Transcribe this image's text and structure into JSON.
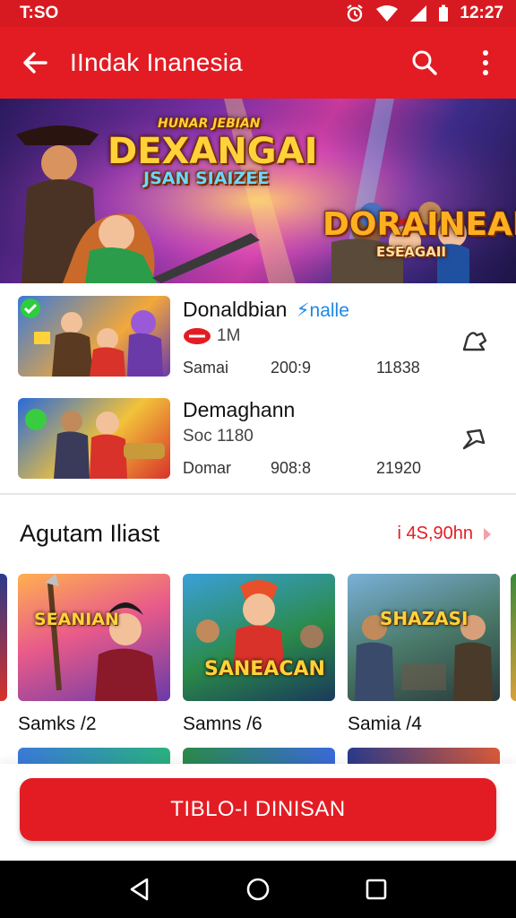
{
  "status_bar": {
    "time": "T:SO",
    "clock": "12:27"
  },
  "app_bar": {
    "title": "IIndak Inanesia"
  },
  "banner": {
    "title_small": "HUNAR JEBIAN",
    "title_main": "DEXANGAI",
    "title_sub": "JSAN SIAIZEE",
    "right_title": "DORAINEAI",
    "right_sub": "ESEAGAII"
  },
  "list": [
    {
      "title": "Donaldbian",
      "tag": "nalle",
      "sub": "1M",
      "stat_label": "Samai",
      "stat_a": "200:9",
      "stat_b": "11838"
    },
    {
      "title": "Demaghann",
      "tag": "",
      "sub": "Soc 1180",
      "stat_label": "Domar",
      "stat_a": "908:8",
      "stat_b": "21920"
    }
  ],
  "section": {
    "title": "Agutam Iliast",
    "link": "i 4S,90hn"
  },
  "grid": [
    {
      "label": "Samks /2",
      "art_text": "SEANIAN"
    },
    {
      "label": "Samns /6",
      "art_text": "SANEACAN"
    },
    {
      "label": "Samia /4",
      "art_text": "SHAZASI"
    }
  ],
  "cta": {
    "label": "TIBLO-I DINISAN"
  },
  "colors": {
    "brand": "#e31c23",
    "status": "#d71a21"
  }
}
